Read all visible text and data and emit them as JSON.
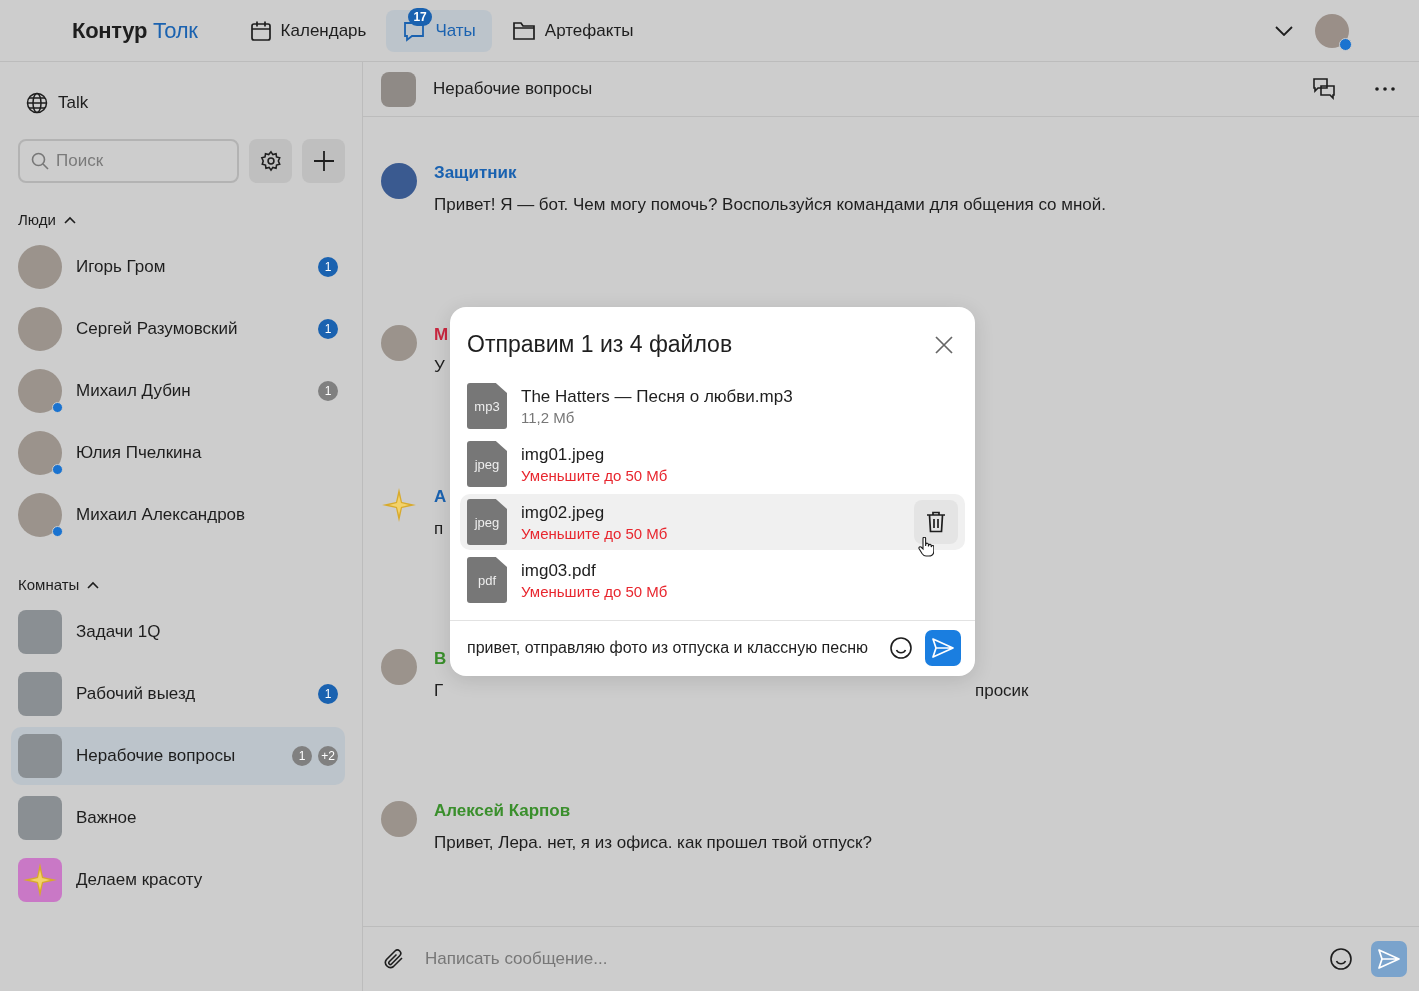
{
  "brand": {
    "name": "Контур",
    "accent": "Толк"
  },
  "nav": [
    {
      "label": "Календарь",
      "selected": false
    },
    {
      "label": "Чаты",
      "selected": true,
      "badge": "17"
    },
    {
      "label": "Артефакты",
      "selected": false
    }
  ],
  "user": {
    "online": true
  },
  "sidebar": {
    "workspace": "Talk",
    "search": {
      "placeholder": "Поиск"
    },
    "sections": [
      {
        "title": "Люди",
        "expanded": true,
        "items": [
          {
            "name": "Игорь Гром",
            "kind": "person",
            "online": false,
            "selected": false,
            "badges": [
              {
                "text": "1",
                "muted": false
              }
            ]
          },
          {
            "name": "Сергей Разумовский",
            "kind": "person",
            "online": false,
            "selected": false,
            "badges": [
              {
                "text": "1",
                "muted": false
              }
            ]
          },
          {
            "name": "Михаил Дубин",
            "kind": "person",
            "online": true,
            "selected": false,
            "badges": [
              {
                "text": "1",
                "muted": true
              }
            ]
          },
          {
            "name": "Юлия Пчелкина",
            "kind": "person",
            "online": true,
            "selected": false
          },
          {
            "name": "Михаил Александров",
            "kind": "person",
            "online": true,
            "selected": false
          }
        ]
      },
      {
        "title": "Комнаты",
        "expanded": true,
        "items": [
          {
            "name": "Задачи 1Q",
            "kind": "room",
            "online": false,
            "selected": false
          },
          {
            "name": "Рабочий выезд",
            "kind": "room",
            "online": false,
            "selected": false,
            "badges": [
              {
                "text": "1",
                "muted": false
              }
            ]
          },
          {
            "name": "Нерабочие вопросы",
            "kind": "room",
            "online": false,
            "selected": true,
            "badges": [
              {
                "text": "1",
                "muted": true
              },
              {
                "text": "+2",
                "muted": true
              }
            ]
          },
          {
            "name": "Важное",
            "kind": "room",
            "online": false,
            "selected": false
          },
          {
            "name": "Делаем красоту",
            "kind": "star",
            "online": false,
            "selected": false
          }
        ]
      }
    ]
  },
  "chat": {
    "title": "Нерабочие вопросы",
    "messages": [
      {
        "author": "Защитник",
        "color": "#1a62b0",
        "kind": "room",
        "text": "Привет! Я — бот. Чем могу помочь? Воспользуйся командами для общения со мной."
      },
      {
        "author": "М",
        "color": "#c8273f",
        "kind": "person",
        "text": "У"
      },
      {
        "author": "А",
        "color": "#1a62b0",
        "kind": "star",
        "text": "п"
      },
      {
        "author": "В",
        "color": "#3a8f2c",
        "kind": "person",
        "text": "Г",
        "text_tail": "просик"
      },
      {
        "author": "Алексей Карпов",
        "color": "#3a8f2c",
        "kind": "person",
        "text": "Привет, Лера. нет, я из офиса. как прошел твой отпуск?"
      }
    ],
    "composer": {
      "placeholder": "Написать сообщение..."
    }
  },
  "dialog": {
    "title": "Отправим 1 из 4 файлов",
    "files": [
      {
        "ext": "mp3",
        "name": "The Hatters — Песня о любви.mp3",
        "note": "11,2 Мб",
        "error": false,
        "hovered": false
      },
      {
        "ext": "jpeg",
        "name": "img01.jpeg",
        "note": "Уменьшите до 50 Мб",
        "error": true,
        "hovered": false
      },
      {
        "ext": "jpeg",
        "name": "img02.jpeg",
        "note": "Уменьшите до 50 Мб",
        "error": true,
        "hovered": true
      },
      {
        "ext": "pdf",
        "name": "img03.pdf",
        "note": "Уменьшите до 50 Мб",
        "error": true,
        "hovered": false
      }
    ],
    "caption": "привет, отправляю фото из отпуска и классную песню"
  }
}
